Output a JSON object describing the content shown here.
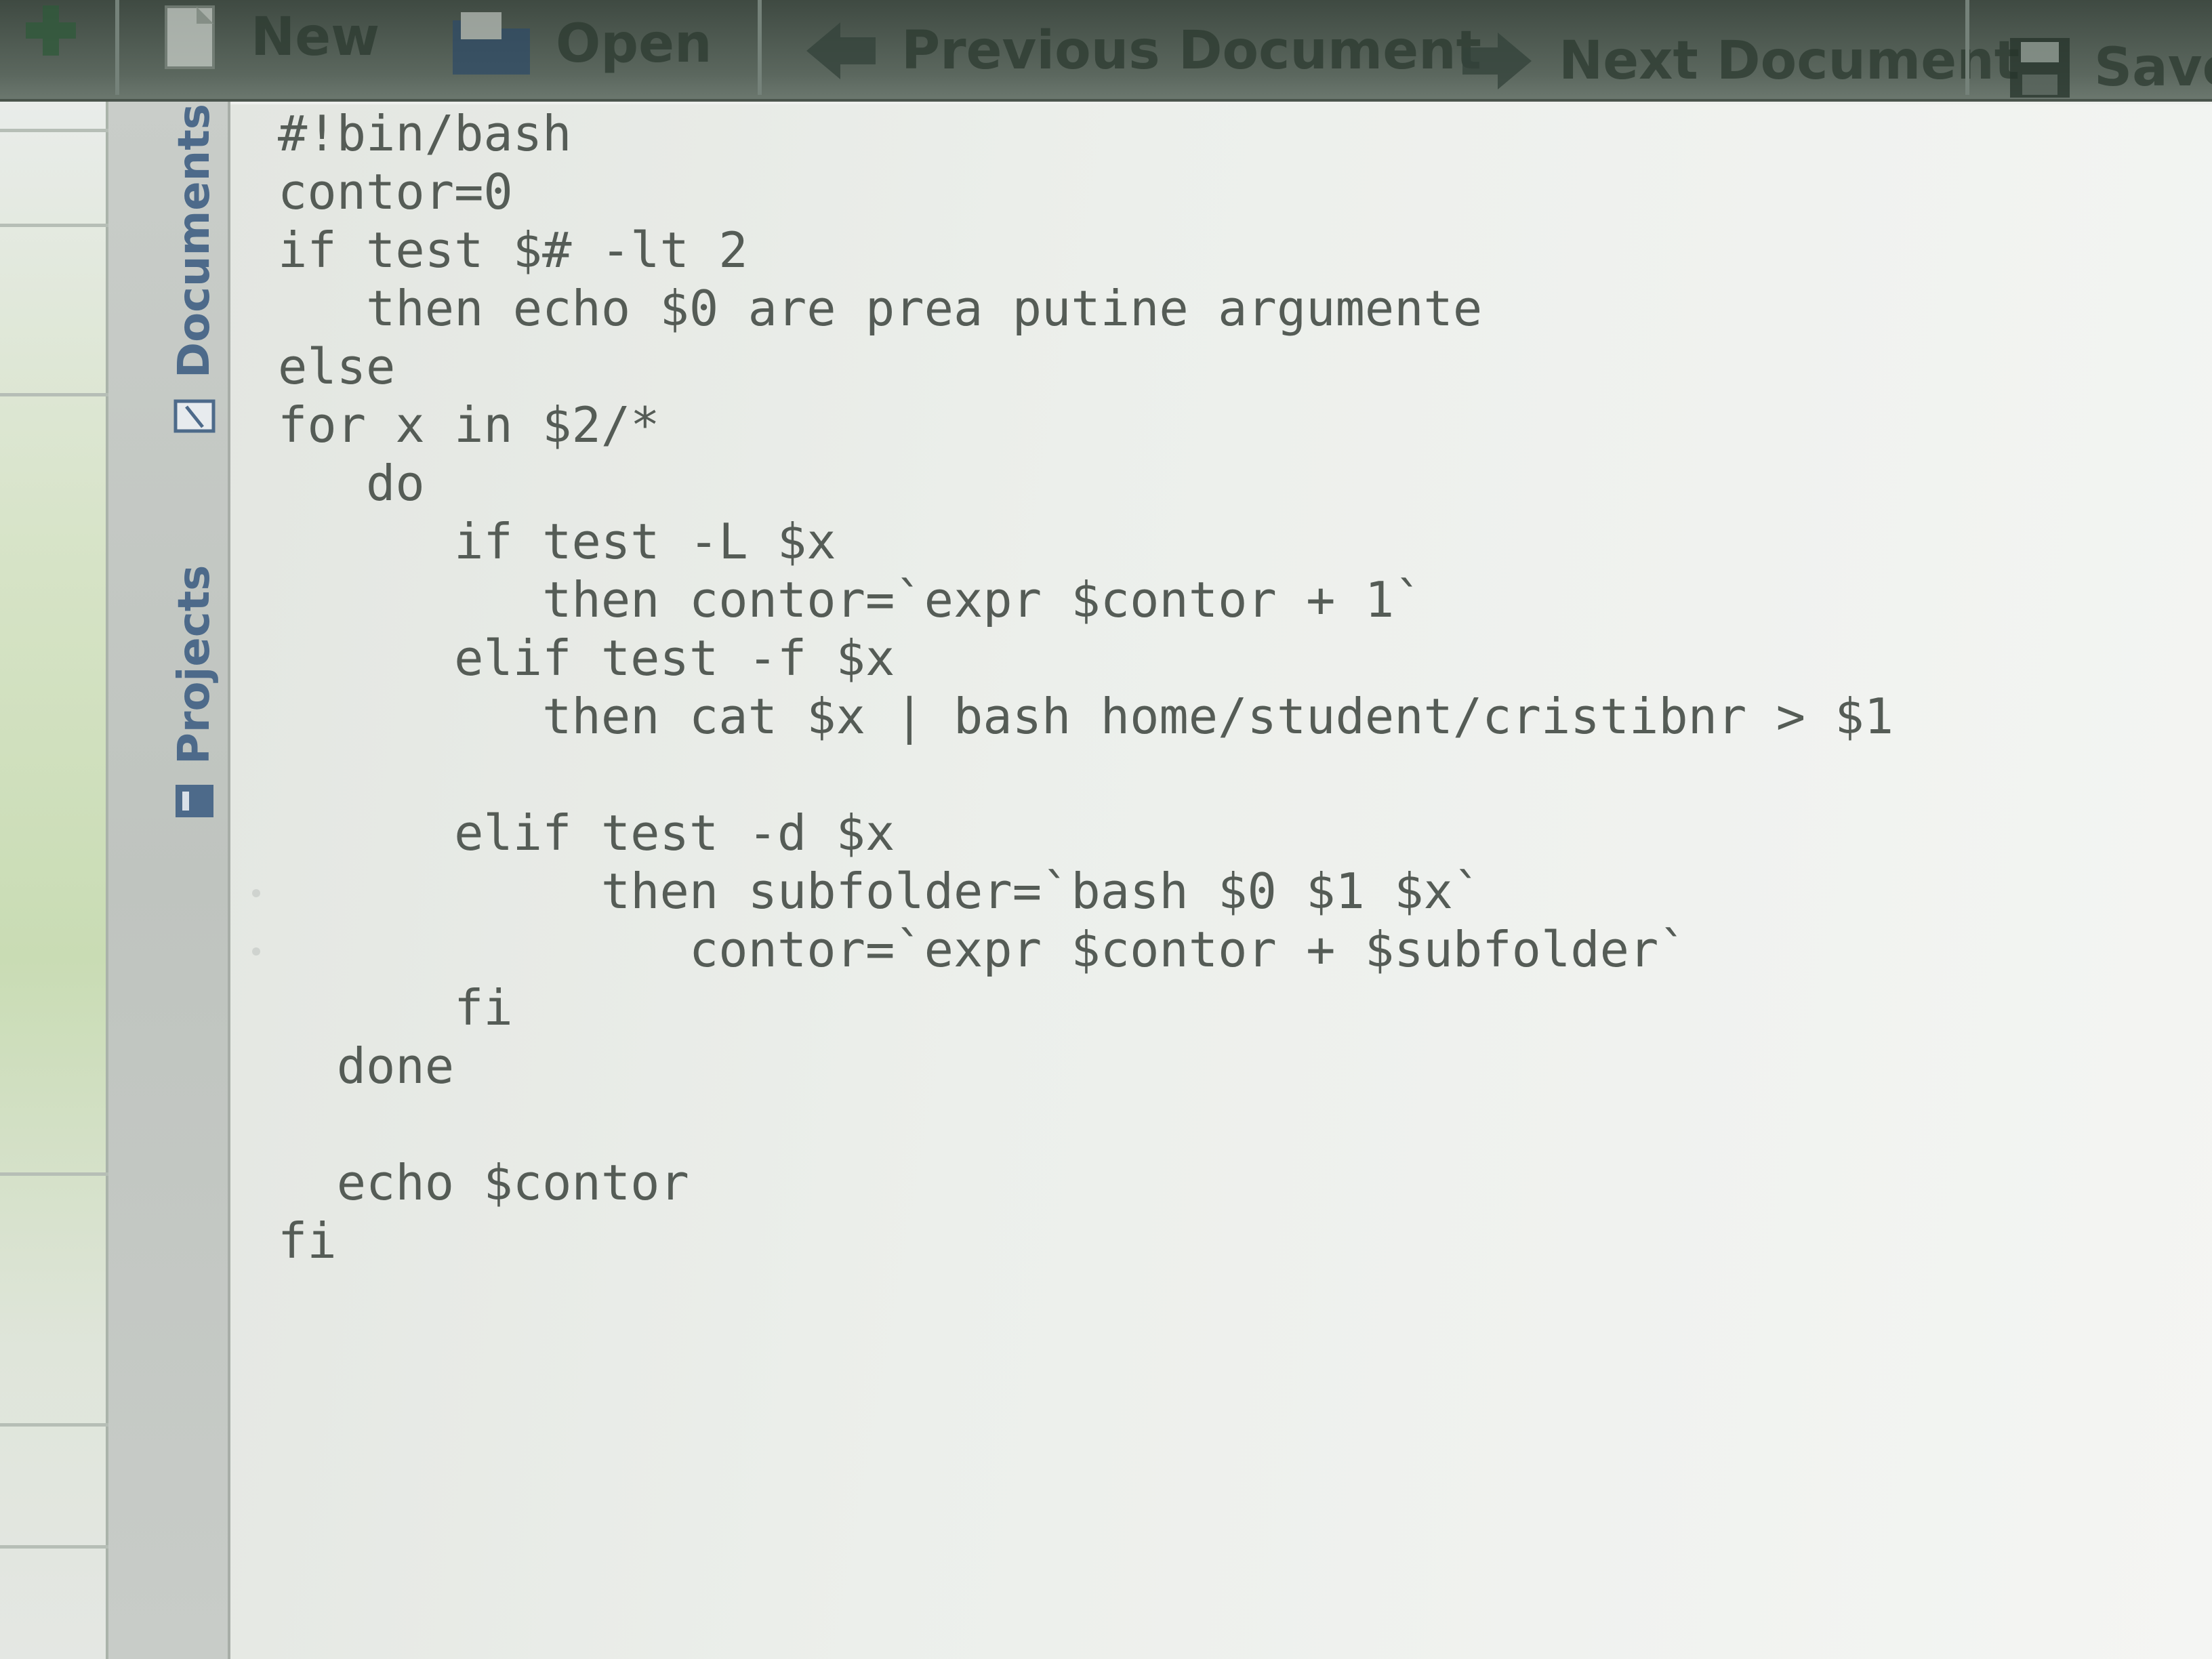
{
  "toolbar": {
    "items": [
      {
        "label": "",
        "icon": "add-icon"
      },
      {
        "label": "New",
        "icon": "new-document-icon"
      },
      {
        "label": "Open",
        "icon": "open-folder-icon"
      },
      {
        "label": "Previous Document",
        "icon": "arrow-left-icon"
      },
      {
        "label": "Next Document",
        "icon": "arrow-right-icon"
      },
      {
        "label": "Save",
        "icon": "save-disk-icon"
      }
    ]
  },
  "side_panel": {
    "tabs": [
      {
        "label": "Documents",
        "icon": "document-icon"
      },
      {
        "label": "Projects",
        "icon": "project-icon"
      }
    ]
  },
  "editor": {
    "lines": [
      "#!bin/bash",
      "contor=0",
      "if test $# -lt 2",
      "   then echo $0 are prea putine argumente",
      "else",
      "for x in $2/*",
      "   do",
      "      if test -L $x",
      "         then contor=`expr $contor + 1`",
      "      elif test -f $x",
      "         then cat $x | bash home/student/cristibnr > $1",
      "",
      "      elif test -d $x",
      "           then subfolder=`bash $0 $1 $x`",
      "              contor=`expr $contor + $subfolder`",
      "      fi",
      "  done",
      "",
      "  echo $contor",
      "fi"
    ]
  },
  "colors": {
    "toolbar": "#4b5a4f",
    "editor_bg": "#eef0ed",
    "code_text": "#555c56",
    "tab_text": "#4d6a8a"
  }
}
